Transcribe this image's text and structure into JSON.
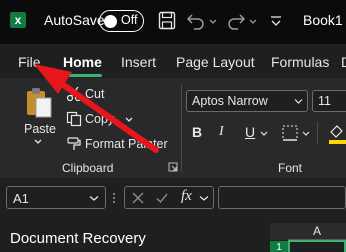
{
  "titlebar": {
    "autosave_label": "AutoSave",
    "autosave_state": "Off",
    "book_name": "Book1"
  },
  "tabs": [
    {
      "label": "File"
    },
    {
      "label": "Home",
      "active": true
    },
    {
      "label": "Insert"
    },
    {
      "label": "Page Layout"
    },
    {
      "label": "Formulas"
    },
    {
      "label": "D"
    }
  ],
  "ribbon": {
    "clipboard": {
      "paste": "Paste",
      "cut": "Cut",
      "copy": "Copy",
      "format_painter": "Format Painter",
      "group_label": "Clipboard"
    },
    "font": {
      "font_name": "Aptos Narrow",
      "font_size": "11",
      "group_label": "Font",
      "bold": "B",
      "italic": "I",
      "underline": "U"
    }
  },
  "formula_bar": {
    "name_box": "A1",
    "fx": "fx"
  },
  "document_recovery": {
    "title": "Document Recovery"
  },
  "grid": {
    "column": "A",
    "row": "1"
  },
  "colors": {
    "accent": "#3bb273",
    "arrow": "#e8151c",
    "excel_green": "#107c41"
  }
}
